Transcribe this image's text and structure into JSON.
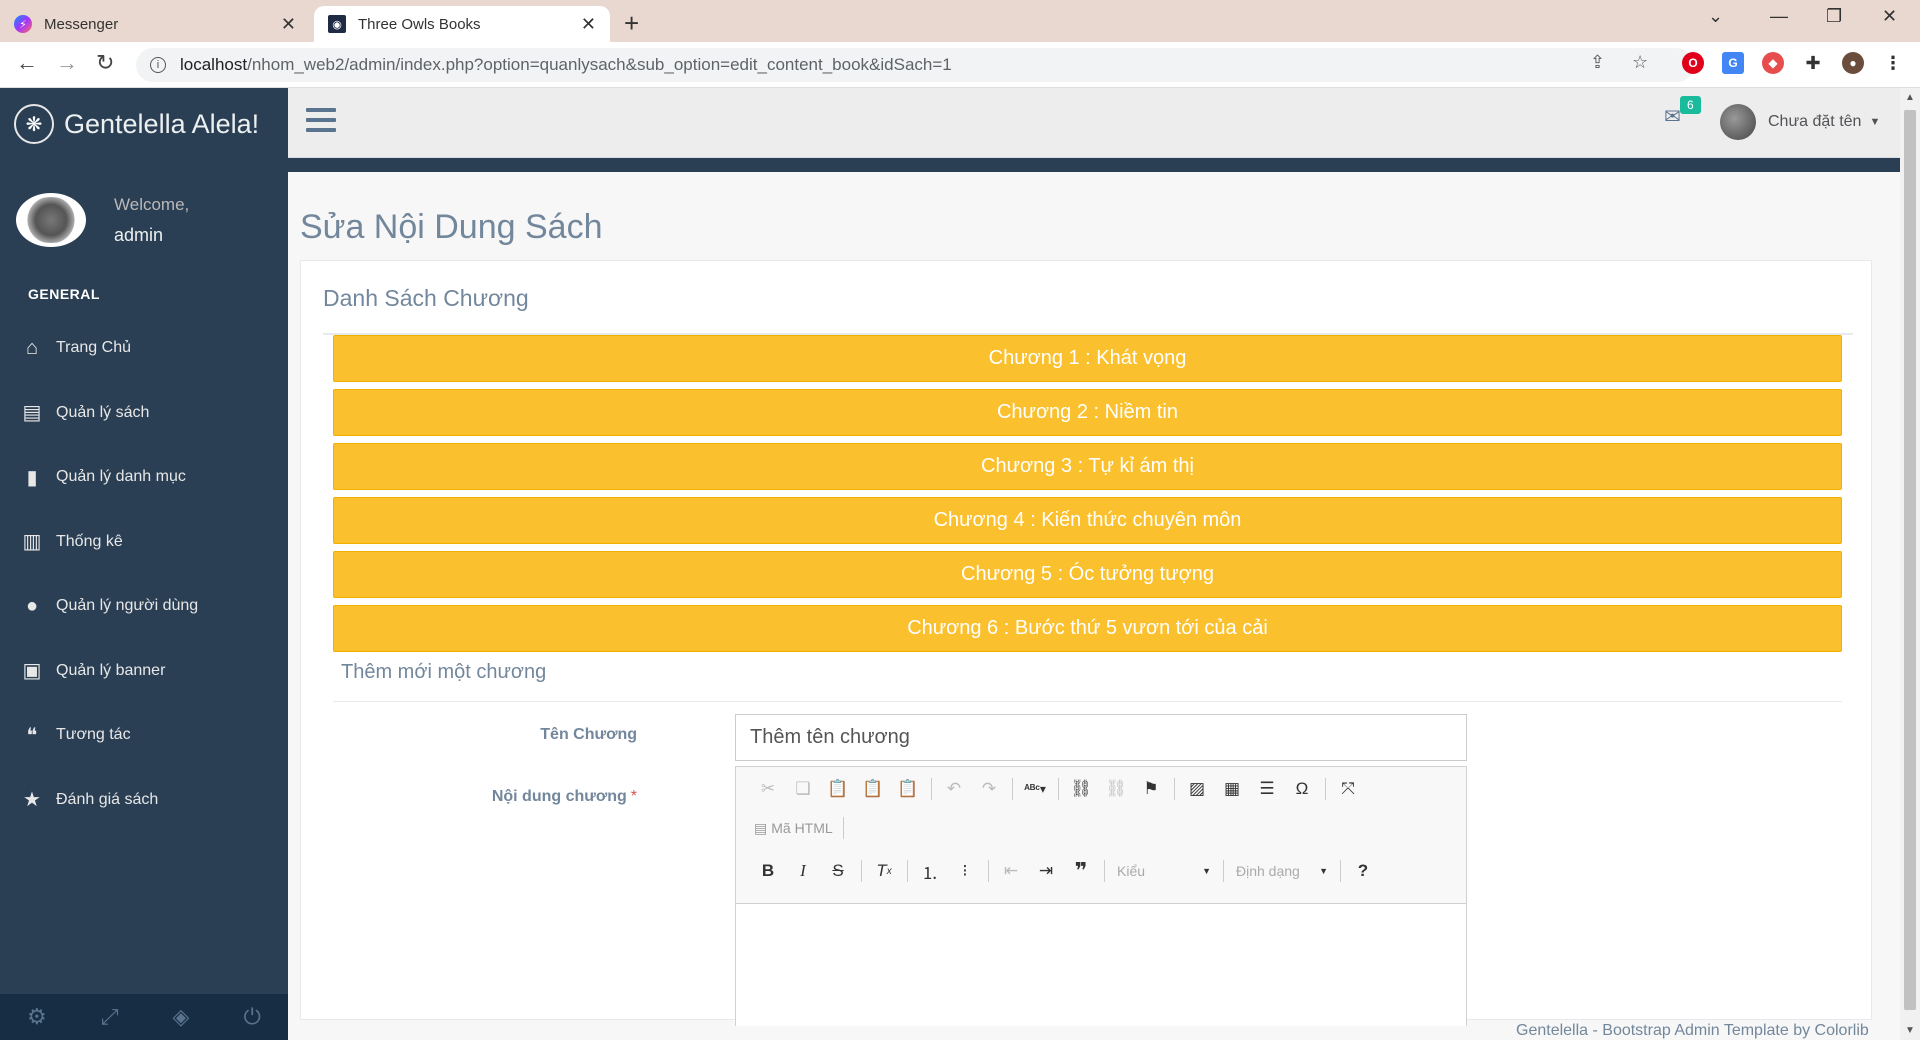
{
  "browser": {
    "tabs": [
      {
        "title": "Messenger",
        "favicon": "messenger-icon"
      },
      {
        "title": "Three Owls Books",
        "favicon": "owl-icon"
      }
    ],
    "url_host": "localhost",
    "url_path": "/nhom_web2/admin/index.php?option=quanlysach&sub_option=edit_content_book&idSach=1"
  },
  "sidebar": {
    "brand": "Gentelella Alela!",
    "welcome": "Welcome,",
    "username": "admin",
    "section": "GENERAL",
    "items": [
      {
        "label": "Trang Chủ",
        "icon": "home-icon",
        "glyph": "⌂"
      },
      {
        "label": "Quản lý sách",
        "icon": "book-icon",
        "glyph": "▤"
      },
      {
        "label": "Quản lý danh mục",
        "icon": "bookmark-icon",
        "glyph": "▮"
      },
      {
        "label": "Thống kê",
        "icon": "bar-chart-icon",
        "glyph": "▥"
      },
      {
        "label": "Quản lý người dùng",
        "icon": "user-icon",
        "glyph": "●"
      },
      {
        "label": "Quản lý banner",
        "icon": "image-icon",
        "glyph": "▣"
      },
      {
        "label": "Tương tác",
        "icon": "comments-icon",
        "glyph": "❝"
      },
      {
        "label": "Đánh giá sách",
        "icon": "star-icon",
        "glyph": "★"
      }
    ]
  },
  "topnav": {
    "mail_count": "6",
    "user_name": "Chưa đặt tên"
  },
  "main": {
    "page_title": "Sửa Nội Dung Sách",
    "panel_title": "Danh Sách Chương",
    "chapters": [
      "Chương 1 : Khát vọng",
      "Chương 2 : Niềm tin",
      "Chương 3 : Tự kỉ ám thị",
      "Chương 4 : Kiến thức chuyên môn",
      "Chương 5 : Óc tưởng tượng",
      "Chương 6 : Bước thứ 5 vươn tới của cải"
    ],
    "add_title": "Thêm mới một chương",
    "name_label": "Tên Chương",
    "name_placeholder": "Thêm tên chương",
    "content_label": "Nội dung chương",
    "content_required": "*",
    "editor": {
      "source_label": "Mã HTML",
      "style_label": "Kiểu",
      "format_label": "Định dạng"
    }
  },
  "footer": "Gentelella - Bootstrap Admin Template by Colorlib",
  "colors": {
    "sidebar_bg": "#2a3f54",
    "chapter_button": "#fbc02d",
    "badge": "#1abb9c"
  }
}
